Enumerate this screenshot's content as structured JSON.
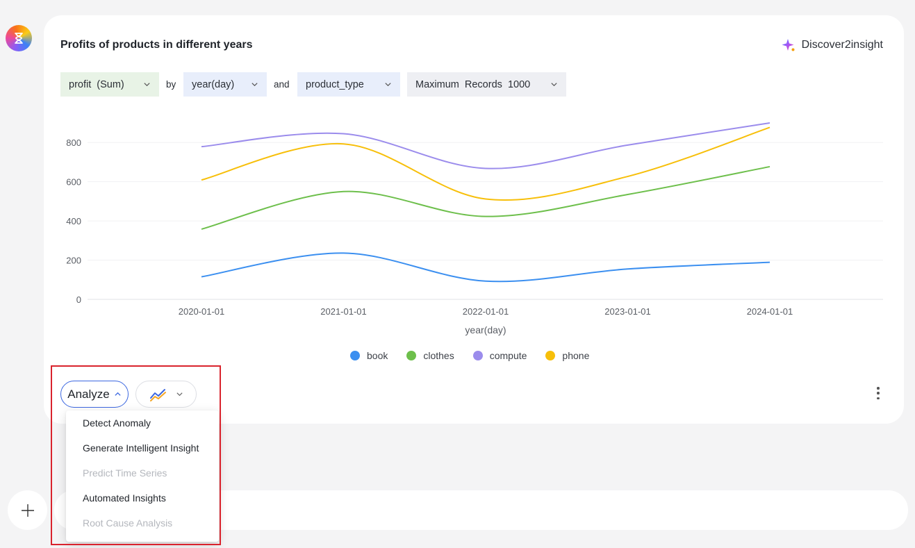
{
  "card": {
    "title": "Profits of products in different years",
    "brand": "Discover2insight"
  },
  "controls": {
    "measure": "profit  (Sum)",
    "by_label": "by",
    "dimension": "year(day)",
    "and_label": "and",
    "group": "product_type",
    "limit": "Maximum  Records  1000"
  },
  "colors": {
    "book": "#3b8ff0",
    "clothes": "#6dbf4b",
    "compute": "#9b8cec",
    "phone": "#f7bf0a",
    "analyze_border": "#3b67e0",
    "highlight": "#d9232d"
  },
  "chart_data": {
    "type": "line",
    "xlabel": "year(day)",
    "ylabel": "",
    "ylim": [
      0,
      900
    ],
    "yticks": [
      0,
      200,
      400,
      600,
      800
    ],
    "x": [
      "2020-01-01",
      "2021-01-01",
      "2022-01-01",
      "2023-01-01",
      "2024-01-01"
    ],
    "grid": true,
    "legend": "bottom",
    "series": [
      {
        "name": "book",
        "values": [
          115,
          236,
          93,
          155,
          189
        ]
      },
      {
        "name": "clothes",
        "values": [
          358,
          550,
          423,
          535,
          677
        ]
      },
      {
        "name": "compute",
        "values": [
          779,
          845,
          668,
          787,
          900
        ]
      },
      {
        "name": "phone",
        "values": [
          609,
          793,
          512,
          627,
          877
        ]
      }
    ]
  },
  "actions": {
    "analyze_label": "Analyze",
    "chart_type_icon": "line-chart-icon"
  },
  "menu": {
    "items": [
      {
        "label": "Detect Anomaly",
        "enabled": true
      },
      {
        "label": "Generate Intelligent Insight",
        "enabled": true
      },
      {
        "label": "Predict Time Series",
        "enabled": false
      },
      {
        "label": "Automated Insights",
        "enabled": true
      },
      {
        "label": "Root Cause Analysis",
        "enabled": false
      }
    ]
  },
  "icons": {
    "logo": "hourglass-icon",
    "brand": "sparkle-icon",
    "more": "more-vertical-icon",
    "add": "plus-icon"
  }
}
